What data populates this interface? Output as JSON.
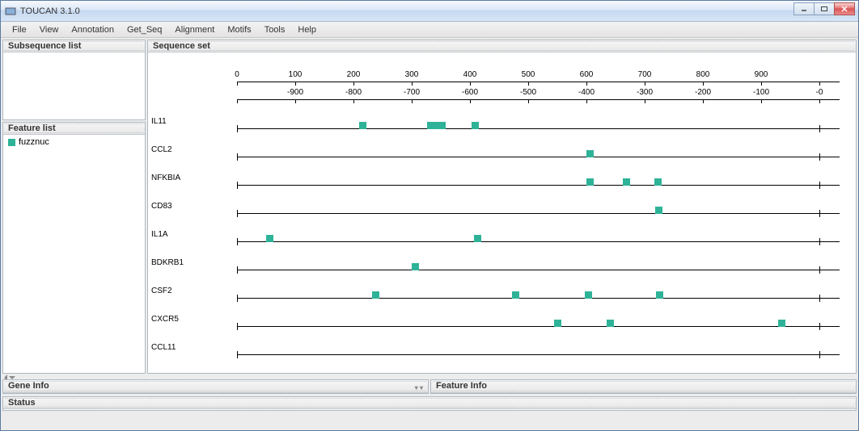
{
  "window": {
    "title": "TOUCAN 3.1.0"
  },
  "menu": {
    "items": [
      "File",
      "View",
      "Annotation",
      "Get_Seq",
      "Alignment",
      "Motifs",
      "Tools",
      "Help"
    ]
  },
  "panels": {
    "subsequence_list": {
      "title": "Subsequence list"
    },
    "feature_list": {
      "title": "Feature list",
      "items": [
        {
          "name": "fuzznuc",
          "color": "#2eb398"
        }
      ]
    },
    "sequence_set": {
      "title": "Sequence set"
    },
    "gene_info": {
      "title": "Gene Info"
    },
    "feature_info": {
      "title": "Feature Info"
    },
    "status": {
      "title": "Status"
    }
  },
  "axis_top": {
    "min": 0,
    "max": 1000,
    "ticks": [
      0,
      100,
      200,
      300,
      400,
      500,
      600,
      700,
      800,
      900
    ]
  },
  "axis_bottom": {
    "min": -1000,
    "max": 0,
    "ticks": [
      -900,
      -800,
      -700,
      -600,
      -500,
      -400,
      -300,
      -200,
      -100,
      0
    ],
    "labels": [
      "-900",
      "-800",
      "-700",
      "-600",
      "-500",
      "-400",
      "-300",
      "-200",
      "-100",
      "-0"
    ]
  },
  "sequences": [
    {
      "name": "IL11",
      "features": [
        215,
        332,
        345,
        352,
        408
      ]
    },
    {
      "name": "CCL2",
      "features": [
        606
      ]
    },
    {
      "name": "NFKBIA",
      "features": [
        605,
        668,
        722
      ]
    },
    {
      "name": "CD83",
      "features": [
        724
      ]
    },
    {
      "name": "IL1A",
      "features": [
        55,
        412
      ]
    },
    {
      "name": "BDKRB1",
      "features": [
        305
      ]
    },
    {
      "name": "CSF2",
      "features": [
        238,
        478,
        603,
        725
      ]
    },
    {
      "name": "CXCR5",
      "features": [
        550,
        640,
        935
      ]
    },
    {
      "name": "CCL11",
      "features": []
    }
  ],
  "colors": {
    "feature": "#2eb398"
  }
}
